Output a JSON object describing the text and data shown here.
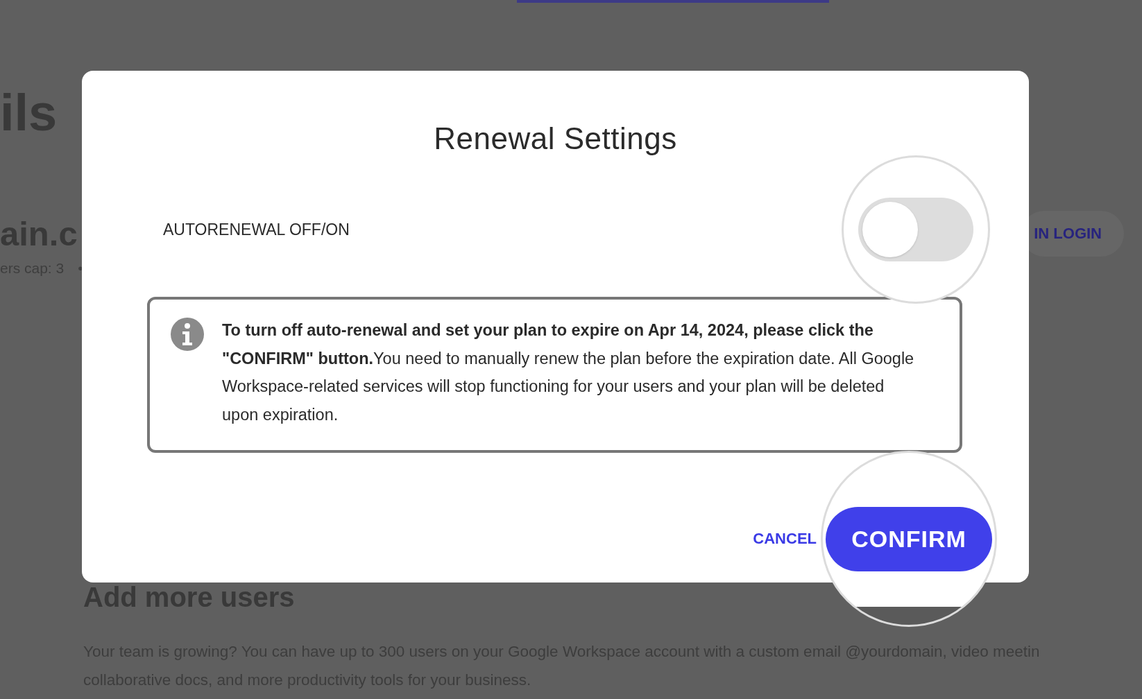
{
  "background_page": {
    "heading": "ils",
    "domain": "ain.c",
    "meta": "ers cap: 3",
    "meta_separator": "•",
    "login_button": "IN LOGIN",
    "section_title": "Add more users",
    "paragraph_lines": [
      "Your team is growing? You can have up to 300 users on your Google Workspace account with a custom email @yourdomain, video meetin",
      "collaborative docs, and more productivity tools for your business."
    ]
  },
  "dialog": {
    "title": "Renewal Settings",
    "autorenewal": {
      "label": "AUTORENEWAL OFF/ON",
      "on": false
    },
    "info": "**To turn off auto-renewal and set your plan to expire on Apr 14, 2024, please click the \"CONFIRM\" button.**You need to manually renew the plan before the expiration date. All Google Workspace-related services will stop functioning for your users and your plan will be deleted upon expiration.",
    "buttons": [
      {
        "kind": "text",
        "label": "CANCEL"
      },
      {
        "kind": "primary",
        "label": "CONFIRM"
      }
    ]
  }
}
